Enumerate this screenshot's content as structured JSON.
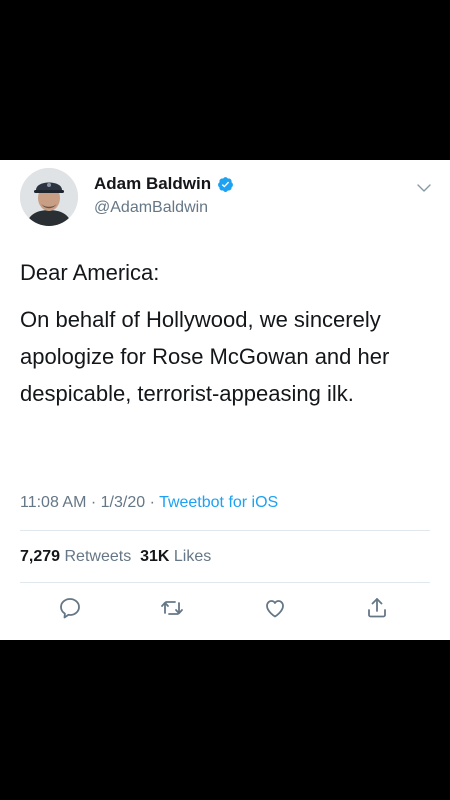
{
  "tweet": {
    "display_name": "Adam Baldwin",
    "handle": "@AdamBaldwin",
    "text_lines": [
      "Dear America:",
      "On behalf of Hollywood, we sincerely apologize for Rose McGowan and her despicable, terrorist-appeasing ilk."
    ],
    "time": "11:08 AM",
    "date": "1/3/20",
    "source": "Tweetbot for iOS",
    "retweets_count": "7,279",
    "retweets_label": "Retweets",
    "likes_count": "31K",
    "likes_label": "Likes"
  },
  "icons": {
    "verified": "verified-badge-icon",
    "more": "chevron-down-icon",
    "reply": "reply-icon",
    "retweet": "retweet-icon",
    "like": "heart-icon",
    "share": "share-icon"
  },
  "colors": {
    "accent": "#1da1f2",
    "text": "#14171a",
    "muted": "#657786",
    "background": "#000000"
  }
}
